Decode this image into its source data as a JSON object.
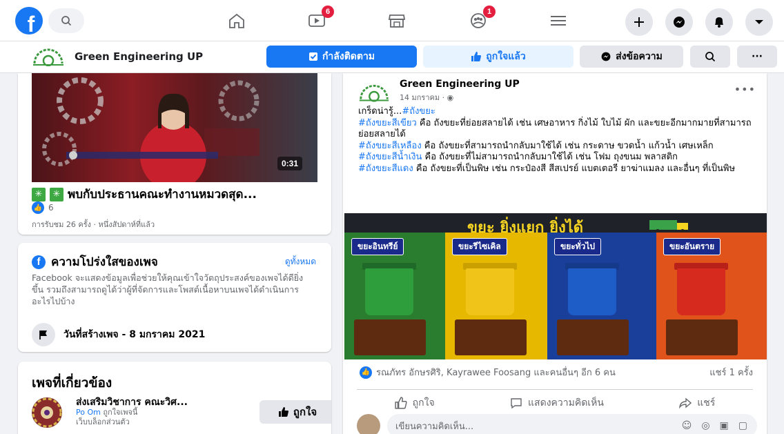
{
  "nav": {
    "logo_letter": "f",
    "watch_badge": "6",
    "groups_badge": "1"
  },
  "page_header": {
    "name": "Green Engineering UP",
    "following_label": "กำลังติดตาม",
    "liked_label": "ถูกใจแล้ว",
    "message_label": "ส่งข้อความ",
    "more_label": "···"
  },
  "video_card": {
    "duration": "0:31",
    "title": "พบกับประธานคณะทำงานหมวดสุด...",
    "like_count": "6",
    "views": "การรับชม 26 ครั้ง · หนึ่งสัปดาห์ที่แล้ว"
  },
  "transparency": {
    "title": "ความโปร่งใสของเพจ",
    "see_all": "ดูทั้งหมด",
    "description": "Facebook จะแสดงข้อมูลเพื่อช่วยให้คุณเข้าใจวัตถุประสงค์ของเพจได้ดียิ่งขึ้น รวมถึงสามารถดูได้ว่าผู้ที่จัดการและโพสต์เนื้อหาบนเพจได้ดำเนินการอะไรไปบ้าง",
    "created": "วันที่สร้างเพจ - 8 มกราคม 2021"
  },
  "related": {
    "title": "เพจที่เกี่ยวข้อง",
    "page_name": "ส่งเสริมวิชาการ คณะวิศ...",
    "liker": "Po Om",
    "liker_suffix": " ถูกใจเพจนี้",
    "category": "เว็บบล็อกส่วนตัว",
    "like_button": "ถูกใจ"
  },
  "post": {
    "author": "Green Engineering UP",
    "date": "14 มกราคม · ",
    "line1_a": "เกร็ดน่ารู้...",
    "line1_tag": "#ถังขยะ",
    "tag_green": "#ถังขยะสีเขียว",
    "text_green": " คือ ถังขยะที่ย่อยสลายได้ เช่น เศษอาหาร กิ่งไม้ ใบไม้ ผัก และขยะอีกมากมายที่สามารถย่อยสลายได้",
    "tag_yellow": "#ถังขยะสีเหลือง",
    "text_yellow": " คือ ถังขยะที่สามารถนำกลับมาใช้ได้ เช่น กระดาษ ขวดน้ำ แก้วน้ำ เศษเหล็ก",
    "tag_blue": "#ถังขยะสีน้ำเงิน",
    "text_blue": " คือ ถังขยะที่ไม่สามารถนำกลับมาใช้ได้ เช่น โฟม ถุงขนม พลาสติก",
    "tag_red": "#ถังขยะสีแดง",
    "text_red": " คือ ถังขยะที่เป็นพิษ เช่น กระป๋องสี สีสเปรย์ แบตเตอรี ยาฆ่าแมลง และอื่นๆ ที่เป็นพิษ",
    "infographic_title": "ขยะ ยิ่งแยก ยิ่งได้",
    "bins": [
      {
        "label": "ขยะอินทรีย์",
        "color": "#2e9e3c",
        "bg": "#2a7d2e"
      },
      {
        "label": "ขยะรีไซเคิล",
        "color": "#f0c419",
        "bg": "#e6b800"
      },
      {
        "label": "ขยะทั่วไป",
        "color": "#1e5cc8",
        "bg": "#1a3f9a"
      },
      {
        "label": "ขยะอันตราย",
        "color": "#d62a1e",
        "bg": "#e0531a"
      }
    ],
    "reactors": "รณภัทร อักษรศิริ, Kayrawee Foosang และคนอื่นๆ อีก 6 คน",
    "shares": "แชร์ 1 ครั้ง",
    "like_action": "ถูกใจ",
    "comment_action": "แสดงความคิดเห็น",
    "share_action": "แชร์",
    "comment_placeholder": "เขียนความคิดเห็น..."
  }
}
